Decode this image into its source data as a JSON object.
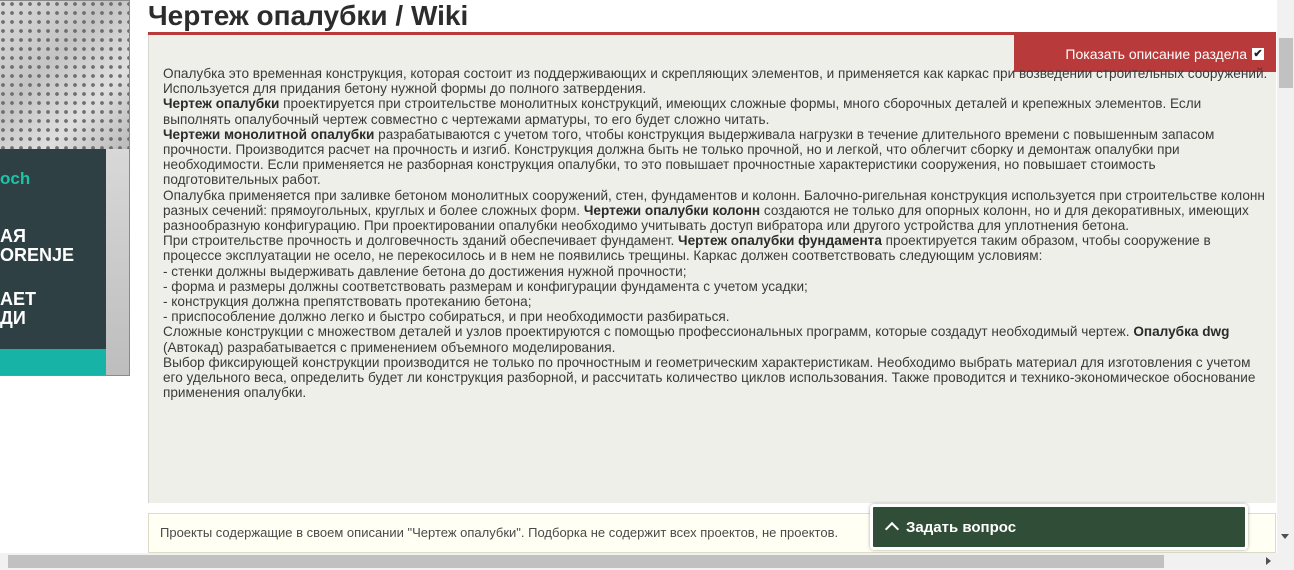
{
  "banner": {
    "brand": "och",
    "line1": [
      "АЯ",
      "ORENJE"
    ],
    "line2": [
      "АЕТ",
      "ДИ"
    ]
  },
  "page": {
    "title": "Чертеж опалубки  /  Wiki"
  },
  "section": {
    "show_desc_label": "Показать описание раздела",
    "checkbox_mark": "✔"
  },
  "description": {
    "p1": "Опалубка это временная конструкция, которая состоит из поддерживающих и скрепляющих элементов, и применяется как каркас при возведении строительных сооружений. Используется для придания бетону нужной формы до полного затвердения.",
    "p2_bold": "Чертеж опалубки",
    "p2": " проектируется при строительстве монолитных конструкций, имеющих сложные формы, много сборочных деталей и крепежных элементов. Если выполнять опалубочный чертеж совместно с чертежами арматуры, то его будет сложно читать.",
    "p3_bold": "Чертежи монолитной опалубки",
    "p3": " разрабатываются с учетом того, чтобы конструкция выдерживала нагрузки в течение длительного времени с повышенным запасом прочности. Производится расчет на прочность и изгиб. Конструкция должна быть не только прочной, но и легкой, что облегчит сборку и демонтаж опалубки при необходимости. Если применяется не разборная конструкция опалубки, то это повышает прочностные характеристики сооружения, но повышает стоимость подготовительных работ.",
    "p4a": "Опалубка применяется при заливке бетоном монолитных сооружений, стен, фундаментов и колонн. Балочно-ригельная конструкция используется при строительстве колонн разных сечений: прямоугольных, круглых и более сложных форм. ",
    "p4_bold": "Чертежи опалубки колонн",
    "p4b": " создаются не только для опорных колонн, но и для декоративных, имеющих разнообразную конфигурацию. При проектировании опалубки необходимо учитывать доступ вибратора или другого устройства для уплотнения бетона.",
    "p5a": "При строительстве прочность и долговечность зданий обеспечивает фундамент. ",
    "p5_bold": "Чертеж опалубки фундамента",
    "p5b": " проектируется таким образом, чтобы сооружение в процессе эксплуатации не осело, не перекосилось и в нем не появились трещины. Каркас должен соответствовать следующим условиям:",
    "conditions": [
      "- стенки должны выдерживать давление бетона до достижения нужной прочности;",
      "- форма и размеры должны соответствовать размерам и конфигурации фундамента с учетом усадки;",
      "- конструкция должна препятствовать протеканию бетона;",
      "- приспособление должно легко и быстро собираться, и при необходимости разбираться."
    ],
    "p6a": "Сложные конструкции с множеством деталей и узлов проектируются с помощью профессиональных программ, которые создадут необходимый чертеж. ",
    "p6_bold": "Опалубка dwg",
    "p6b": " (Автокад) разрабатывается с применением объемного моделирования.",
    "p7": "Выбор фиксирующей конструкции производится не только по прочностным и геометрическим характеристикам. Необходимо выбрать материал для изготовления с учетом его удельного веса, определить будет ли конструкция разборной, и рассчитать количество циклов использования. Также проводится и технико-экономическое обоснование применения опалубки."
  },
  "projects_notice": "Проекты содержащие в своем описании \"Чертеж опалубки\". Подборка не содержит всех проектов, не                                                                                              проектов.",
  "ask_button": {
    "label": "Задать вопрос"
  }
}
